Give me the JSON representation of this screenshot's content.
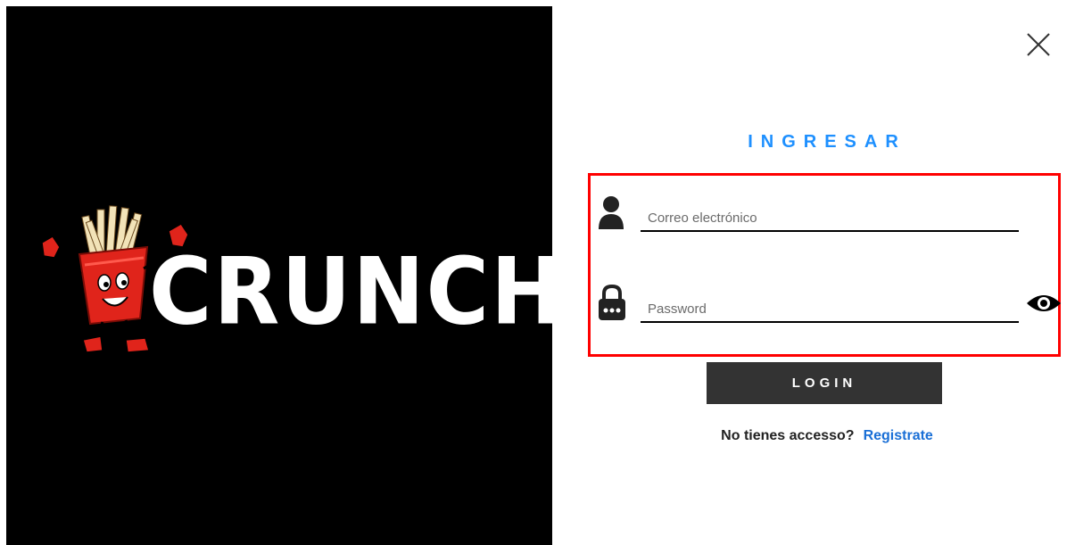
{
  "brand": {
    "logo_text": "CRUNCHY",
    "background": "#000000",
    "mascot_icon": "fries-mascot-icon"
  },
  "login": {
    "title": "INGRESAR",
    "title_color": "#1e90ff",
    "email": {
      "placeholder": "Correo electrónico",
      "value": "",
      "icon": "user-icon"
    },
    "password": {
      "placeholder": "Password",
      "value": "",
      "icon": "lock-icon",
      "toggle_icon": "eye-icon"
    },
    "submit_label": "LOGIN",
    "register_prompt": "No tienes accesso?",
    "register_link": "Registrate",
    "link_color": "#1a6fd6",
    "highlight_border_color": "#ff0000"
  }
}
